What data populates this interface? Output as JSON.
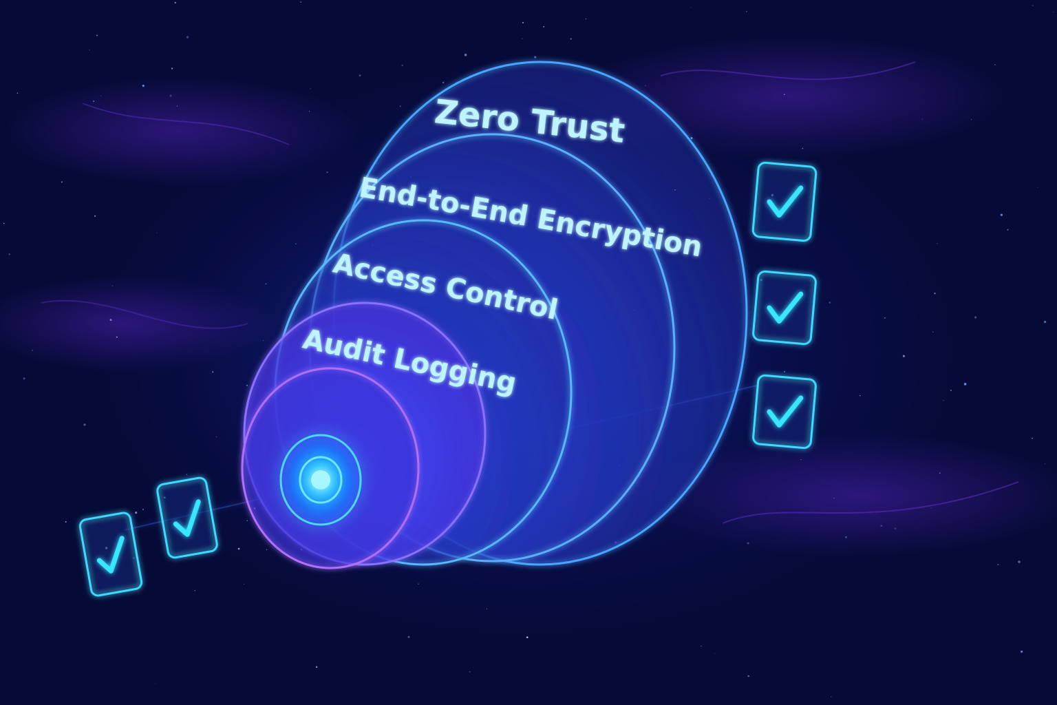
{
  "layers": [
    {
      "label": "Zero Trust"
    },
    {
      "label": "End-to-End Encryption"
    },
    {
      "label": "Access Control"
    },
    {
      "label": "Audit Logging"
    }
  ],
  "colors": {
    "background": "#060a36",
    "layer_outline": "#4aa6ff",
    "inner_outline": "#a06bff",
    "label_text": "#bdf4ff",
    "check_accent": "#38e6ff",
    "core": "#2fd6ff"
  },
  "checkmarks": {
    "right_column_count": 3,
    "left_group_count": 2,
    "icon": "checkbox-checked-icon"
  }
}
